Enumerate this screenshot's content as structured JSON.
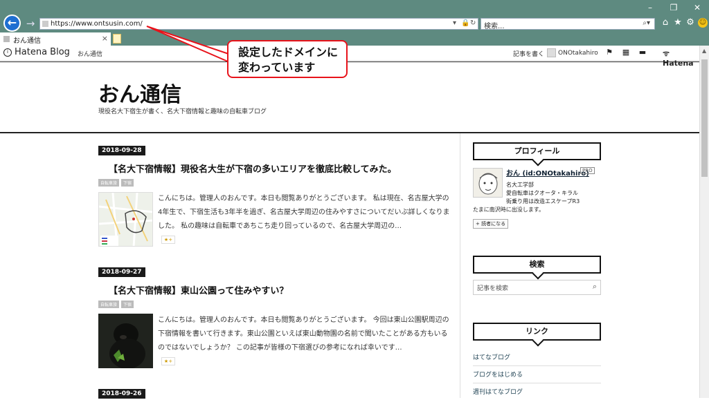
{
  "browser": {
    "url": "https://www.ontsusin.com/",
    "search_placeholder": "検索...",
    "tab_title": "おん通信",
    "tab_close": "×",
    "window_controls": [
      "–",
      "❐",
      "✕"
    ],
    "back_icon": "arrow-left-icon",
    "forward_icon": "arrow-right-icon"
  },
  "hatena_bar": {
    "logo": "Hatena Blog",
    "blog_name": "おん通信",
    "write_link": "記事を書く",
    "username": "ONOtakahiro",
    "brand": "Hatena"
  },
  "header": {
    "title": "おん通信",
    "description": "現役名大下宿生が書く、名大下宿情報と趣味の自転車ブログ"
  },
  "articles": [
    {
      "date": "2018-09-28",
      "title": "【名大下宿情報】現役名大生が下宿の多いエリアを徹底比較してみた。",
      "categories": [
        "自転車旅",
        "下宿"
      ],
      "excerpt": "こんにちは。管理人のおんです。本日も閲覧ありがとうございます。 私は現在、名古屋大学の4年生で、下宿生活も3年半を過ぎ、名古屋大学周辺の住みやすさについてだいぶ詳しくなりました。 私の趣味は自転車であちこち走り回っているので、名古屋大学周辺の…",
      "star": "★+"
    },
    {
      "date": "2018-09-27",
      "title": "【名大下宿情報】東山公園って住みやすい？",
      "categories": [
        "自転車旅",
        "下宿"
      ],
      "excerpt": "こんにちは。管理人のおんです。本日も閲覧ありがとうございます。 今回は東山公園駅周辺の下宿情報を書いて行きます。東山公園といえば東山動物園の名前で聞いたことがある方もいるのではないでしょうか？ この記事が皆様の下宿選びの参考になれば幸いです…",
      "star": "★+"
    },
    {
      "date": "2018-09-26"
    }
  ],
  "sidebar": {
    "profile_heading": "プロフィール",
    "profile_name": "おん (id:ONOtakahiro)",
    "pro_badge": "PRO",
    "profile_lines": [
      "名大工学部",
      "愛自転車はクオータ・キラル",
      "街乗り用は改造エスケープR3",
      "たまに南沢時に出没します。"
    ],
    "follow_button": "+ 読者になる",
    "search_heading": "検索",
    "search_placeholder": "記事を検索",
    "links_heading": "リンク",
    "links": [
      "はてなブログ",
      "ブログをはじめる",
      "週刊はてなブログ"
    ]
  },
  "annotation": {
    "line1": "設定したドメインに",
    "line2": "変わっています",
    "color": "#e8121a"
  }
}
